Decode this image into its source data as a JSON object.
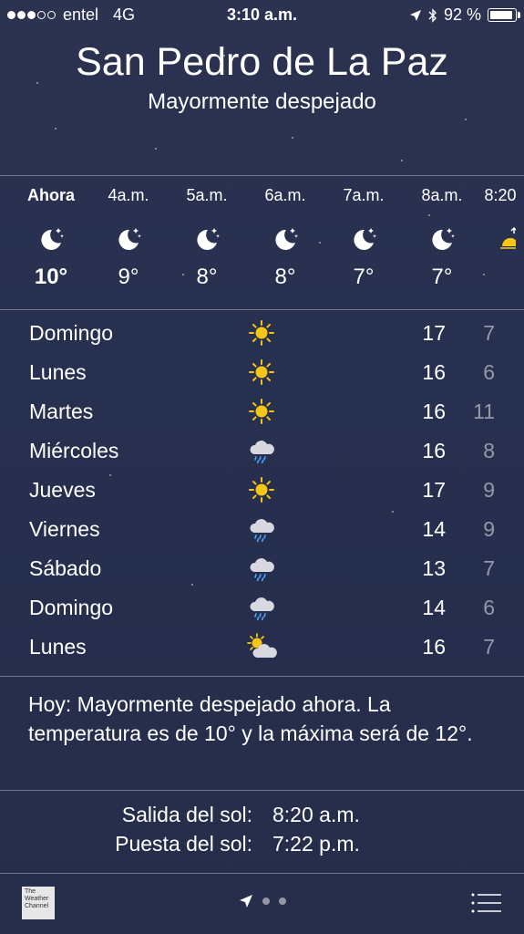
{
  "status": {
    "carrier": "entel",
    "network": "4G",
    "time": "3:10 a.m.",
    "battery": "92 %",
    "icons": [
      "signal-dots-icon",
      "location-arrow-icon",
      "bluetooth-icon",
      "battery-icon"
    ]
  },
  "header": {
    "city": "San Pedro de La Paz",
    "condition": "Mayormente despejado"
  },
  "hourly": [
    {
      "label": "Ahora",
      "icon": "moon-stars-icon",
      "temp": "10°",
      "now": true
    },
    {
      "label": "4a.m.",
      "icon": "moon-stars-icon",
      "temp": "9°"
    },
    {
      "label": "5a.m.",
      "icon": "moon-stars-icon",
      "temp": "8°"
    },
    {
      "label": "6a.m.",
      "icon": "moon-stars-icon",
      "temp": "8°"
    },
    {
      "label": "7a.m.",
      "icon": "moon-stars-icon",
      "temp": "7°"
    },
    {
      "label": "8a.m.",
      "icon": "moon-stars-icon",
      "temp": "7°"
    },
    {
      "label": "8:20",
      "icon": "sunrise-icon",
      "temp": ""
    }
  ],
  "daily": [
    {
      "day": "Domingo",
      "icon": "sun-icon",
      "hi": "17",
      "lo": "7"
    },
    {
      "day": "Lunes",
      "icon": "sun-icon",
      "hi": "16",
      "lo": "6"
    },
    {
      "day": "Martes",
      "icon": "sun-icon",
      "hi": "16",
      "lo": "11"
    },
    {
      "day": "Miércoles",
      "icon": "rain-cloud-icon",
      "hi": "16",
      "lo": "8"
    },
    {
      "day": "Jueves",
      "icon": "sun-icon",
      "hi": "17",
      "lo": "9"
    },
    {
      "day": "Viernes",
      "icon": "rain-cloud-icon",
      "hi": "14",
      "lo": "9"
    },
    {
      "day": "Sábado",
      "icon": "rain-cloud-icon",
      "hi": "13",
      "lo": "7"
    },
    {
      "day": "Domingo",
      "icon": "rain-cloud-icon",
      "hi": "14",
      "lo": "6"
    },
    {
      "day": "Lunes",
      "icon": "partly-cloudy-icon",
      "hi": "16",
      "lo": "7"
    }
  ],
  "summary": "Hoy: Mayormente despejado ahora. La temperatura es de 10° y la máxima será de 12°.",
  "sun": {
    "sunrise_label": "Salida del sol:",
    "sunrise": "8:20 a.m.",
    "sunset_label": "Puesta del sol:",
    "sunset": "7:22 p.m."
  },
  "toolbar": {
    "logo": "The Weather Channel",
    "page_count": 3,
    "current_page": 1,
    "icons": [
      "weather-channel-logo",
      "location-arrow-icon",
      "page-dot-icon",
      "list-icon"
    ]
  },
  "colors": {
    "background": "#283050",
    "sun": "#f5c518",
    "rain": "#4aa8ff",
    "cloud": "#d8d8e0"
  }
}
